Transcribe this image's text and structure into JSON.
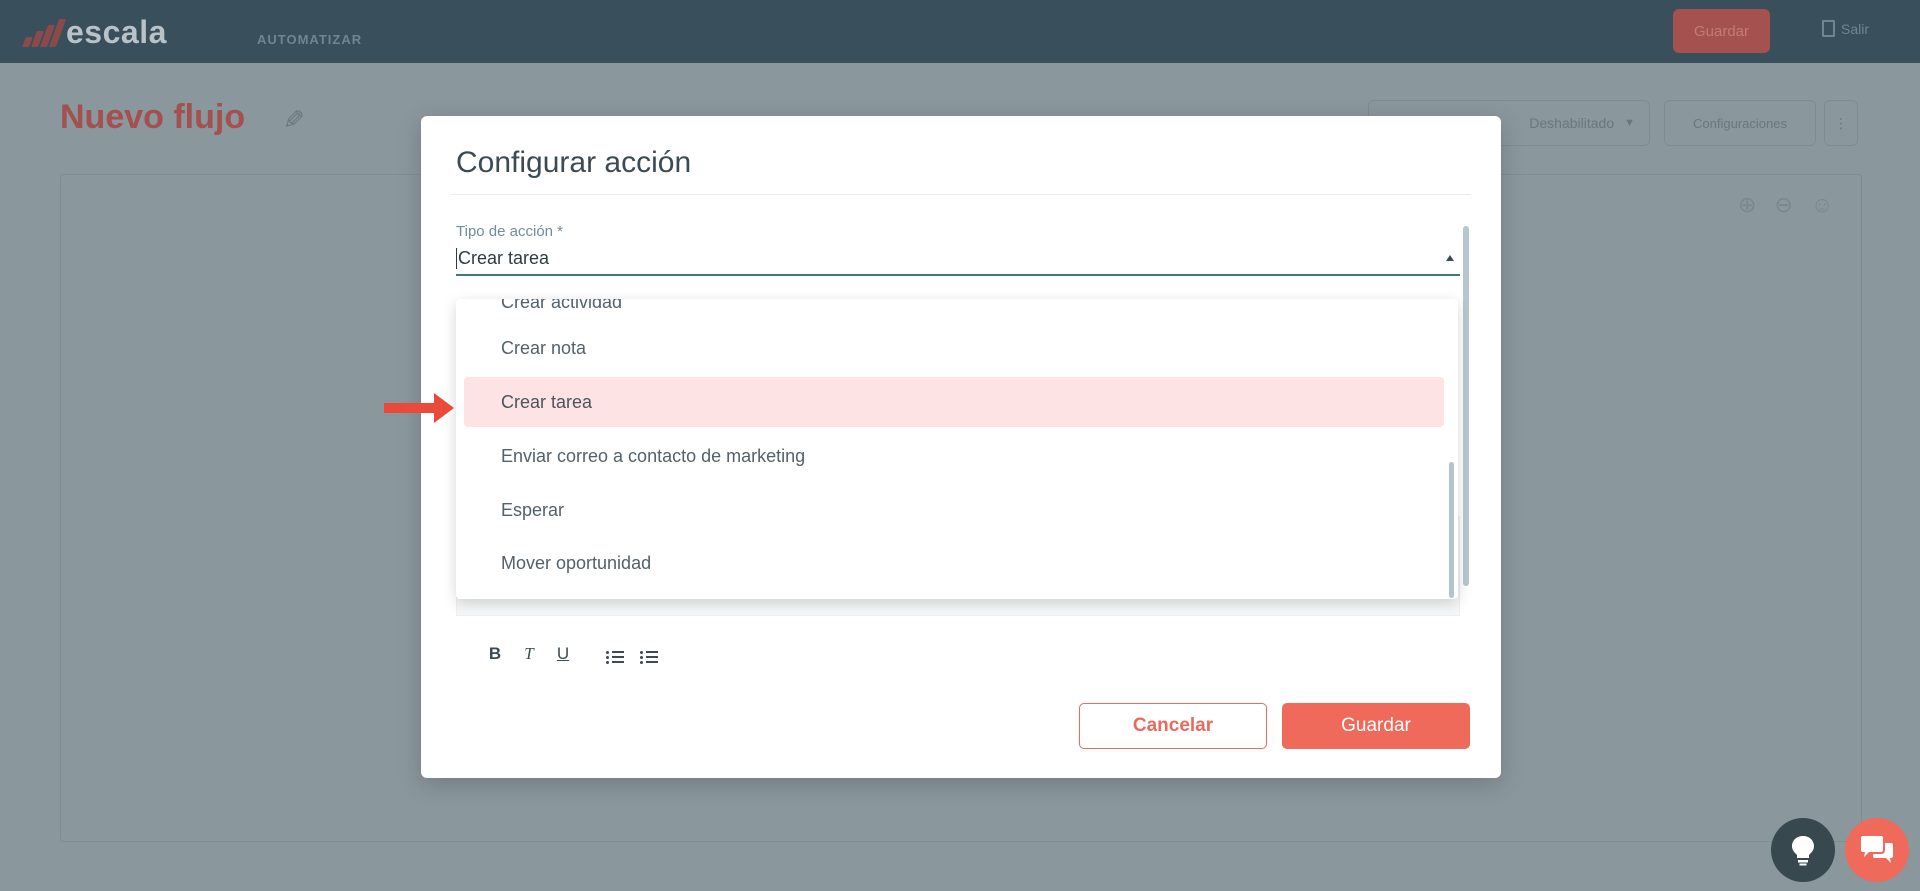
{
  "app": {
    "logo_text": "escala",
    "nav_label": "AUTOMATIZAR",
    "save_label": "Guardar",
    "exit_label": "Salir"
  },
  "page": {
    "title": "Nuevo flujo",
    "status_select": "Deshabilitado",
    "settings_label": "Configuraciones"
  },
  "modal": {
    "title": "Configurar acción",
    "field_label": "Tipo de acción *",
    "field_value": "Crear tarea",
    "cancel_label": "Cancelar",
    "save_label": "Guardar"
  },
  "dropdown": {
    "items": [
      {
        "label": "Crear actividad",
        "selected": false
      },
      {
        "label": "Crear nota",
        "selected": false
      },
      {
        "label": "Crear tarea",
        "selected": true
      },
      {
        "label": "Enviar correo a contacto de marketing",
        "selected": false
      },
      {
        "label": "Esperar",
        "selected": false
      },
      {
        "label": "Mover oportunidad",
        "selected": false
      }
    ]
  },
  "toolbar": {
    "bold": "B",
    "italic": "T",
    "underline": "U"
  },
  "colors": {
    "accent": "#f06a5b",
    "selected_bg": "#fde3e3",
    "topbar": "#3a4f5c",
    "field_underline": "#3e7a78",
    "overlay": "#8a979d"
  }
}
